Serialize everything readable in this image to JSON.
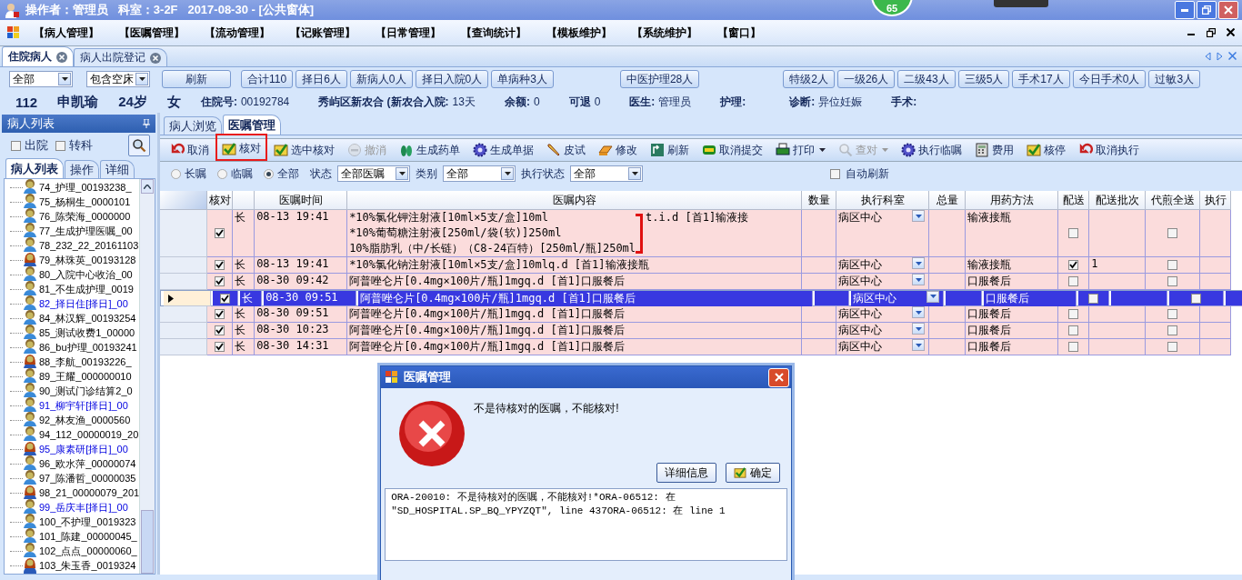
{
  "title_bar": {
    "text": "操作者：管理员   科室：3-2F   2017-08-30 - [公共窗体]",
    "badge": "65"
  },
  "menu": [
    "【病人管理】",
    "【医嘱管理】",
    "【流动管理】",
    "【记账管理】",
    "【日常管理】",
    "【查询统计】",
    "【模板维护】",
    "【系统维护】",
    "【窗口】"
  ],
  "doc_tabs": [
    {
      "label": "住院病人",
      "selected": true
    },
    {
      "label": "病人出院登记",
      "selected": false
    }
  ],
  "filter": {
    "selects": [
      "全部",
      "包含空床"
    ],
    "buttons": [
      "刷新",
      "合计110",
      "择日6人",
      "新病人0人",
      "择日入院0人",
      "单病种3人",
      "中医护理28人"
    ],
    "buttons_right": [
      "特级2人",
      "一级26人",
      "二级43人",
      "三级5人",
      "手术17人",
      "今日手术0人",
      "过敏3人"
    ]
  },
  "patient_info": {
    "bed": "112",
    "name": "申凯瑜",
    "age": "24岁",
    "sex": "女",
    "fields": [
      {
        "label": "住院号:",
        "value": "00192784"
      },
      {
        "label": "秀屿区新农合 (新农合入院:",
        "value": "13天"
      },
      {
        "label": "余额:",
        "value": "0"
      },
      {
        "label": "可退",
        "value": "0"
      },
      {
        "label": "医生:",
        "value": "管理员"
      },
      {
        "label": "护理:"
      },
      {
        "label": "诊断:",
        "value": "异位妊娠"
      },
      {
        "label": "手术:"
      }
    ]
  },
  "sidebar": {
    "title": "病人列表",
    "checks": [
      {
        "label": "出院",
        "checked": false
      },
      {
        "label": "转科",
        "checked": false
      }
    ],
    "tabs": [
      {
        "label": "病人列表",
        "selected": true
      },
      {
        "label": "操作",
        "selected": false
      },
      {
        "label": "详细",
        "selected": false
      }
    ],
    "patients": [
      {
        "label": "74_护理_00193238_",
        "female": false,
        "scheduled": false
      },
      {
        "label": "75_杨桐生_0000101",
        "female": false,
        "scheduled": false
      },
      {
        "label": "76_陈荣海_0000000",
        "female": false,
        "scheduled": false
      },
      {
        "label": "77_生成护理医嘱_00",
        "female": false,
        "scheduled": false
      },
      {
        "label": "78_232_22_20161103",
        "female": false,
        "scheduled": false
      },
      {
        "label": "79_林珠英_00193128",
        "female": true,
        "scheduled": false
      },
      {
        "label": "80_入院中心收治_00",
        "female": false,
        "scheduled": false
      },
      {
        "label": "81_不生成护理_0019",
        "female": false,
        "scheduled": false
      },
      {
        "label": "82_择日住[择日]_00",
        "female": false,
        "scheduled": true
      },
      {
        "label": "84_林汉辉_00193254",
        "female": false,
        "scheduled": false
      },
      {
        "label": "85_测试收费1_00000",
        "female": false,
        "scheduled": false
      },
      {
        "label": "86_bu护理_00193241",
        "female": false,
        "scheduled": false
      },
      {
        "label": "88_李航_00193226_",
        "female": true,
        "scheduled": false
      },
      {
        "label": "89_王耀_000000010",
        "female": false,
        "scheduled": false
      },
      {
        "label": "90_测试门诊结算2_0",
        "female": false,
        "scheduled": false
      },
      {
        "label": "91_柳宇轩[择日]_00",
        "female": false,
        "scheduled": true
      },
      {
        "label": "92_林友渔_0000560",
        "female": false,
        "scheduled": false
      },
      {
        "label": "94_112_00000019_20",
        "female": false,
        "scheduled": false
      },
      {
        "label": "95_康素研[择日]_00",
        "female": true,
        "scheduled": true
      },
      {
        "label": "96_欧水萍_00000074",
        "female": false,
        "scheduled": false
      },
      {
        "label": "97_陈潘哲_00000035",
        "female": false,
        "scheduled": false
      },
      {
        "label": "98_21_00000079_201",
        "female": true,
        "scheduled": false
      },
      {
        "label": "99_岳庆丰[择日]_00",
        "female": false,
        "scheduled": true
      },
      {
        "label": "100_不护理_0019323",
        "female": false,
        "scheduled": false
      },
      {
        "label": "101_陈建_00000045_",
        "female": false,
        "scheduled": false
      },
      {
        "label": "102_点点_00000060_",
        "female": false,
        "scheduled": false
      },
      {
        "label": "103_朱玉香_0019324",
        "female": true,
        "scheduled": false
      }
    ]
  },
  "sub_tabs": [
    {
      "label": "病人浏览",
      "selected": false
    },
    {
      "label": "医嘱管理",
      "selected": true
    }
  ],
  "toolbar": [
    {
      "label": "取消",
      "disabled": false,
      "highlighted": false,
      "dropdown": false
    },
    {
      "label": "核对",
      "disabled": false,
      "highlighted": true,
      "dropdown": false
    },
    {
      "label": "选中核对",
      "disabled": false,
      "highlighted": false,
      "dropdown": false
    },
    {
      "label": "撤消",
      "disabled": true,
      "highlighted": false,
      "dropdown": false
    },
    {
      "label": "生成药单",
      "disabled": false,
      "highlighted": false,
      "dropdown": false
    },
    {
      "label": "生成单据",
      "disabled": false,
      "highlighted": false,
      "dropdown": false
    },
    {
      "label": "皮试",
      "disabled": false,
      "highlighted": false,
      "dropdown": false
    },
    {
      "label": "修改",
      "disabled": false,
      "highlighted": false,
      "dropdown": false
    },
    {
      "label": "刷新",
      "disabled": false,
      "highlighted": false,
      "dropdown": false
    },
    {
      "label": "取消提交",
      "disabled": false,
      "highlighted": false,
      "dropdown": false
    },
    {
      "label": "打印",
      "disabled": false,
      "highlighted": false,
      "dropdown": true
    },
    {
      "label": "查对",
      "disabled": true,
      "highlighted": false,
      "dropdown": true
    },
    {
      "label": "执行临嘱",
      "disabled": false,
      "highlighted": false,
      "dropdown": false
    },
    {
      "label": "费用",
      "disabled": false,
      "highlighted": false,
      "dropdown": false
    },
    {
      "label": "核停",
      "disabled": false,
      "highlighted": false,
      "dropdown": false
    },
    {
      "label": "取消执行",
      "disabled": false,
      "highlighted": false,
      "dropdown": false
    }
  ],
  "order_filter": {
    "radios": [
      {
        "label": "长嘱",
        "selected": false
      },
      {
        "label": "临嘱",
        "selected": false
      },
      {
        "label": "全部",
        "selected": true
      }
    ],
    "fields": [
      {
        "label": "状态",
        "value": "全部医嘱"
      },
      {
        "label": "类别",
        "value": "全部"
      },
      {
        "label": "执行状态",
        "value": "全部"
      }
    ],
    "auto_refresh": {
      "label": "自动刷新",
      "checked": false
    }
  },
  "table": {
    "columns": [
      "核对",
      "医嘱时间",
      "医嘱内容",
      "数量",
      "执行科室",
      "总量",
      "用药方法",
      "配送",
      "配送批次",
      "代煎全送",
      "执行"
    ],
    "rows": [
      {
        "checked": true,
        "type": "长",
        "time": "08-13 19:41",
        "content": [
          "*10%氯化钾注射液[10ml×5支/盒]10ml",
          "*10%葡萄糖注射液[250ml/袋(软)]250ml",
          "10%脂肪乳（中/长链）（C8-24百特）[250ml/瓶]250ml"
        ],
        "frequency": "t.i.d  [首1]输液接",
        "dept": "病区中心",
        "method": "输液接瓶",
        "delivery": false,
        "decoct": false,
        "selected": false
      },
      {
        "checked": true,
        "type": "长",
        "time": "08-13 19:41",
        "content": [
          "*10%氯化钠注射液[10ml×5支/盒]10mlq.d  [首1]输液接瓶"
        ],
        "dept": "病区中心",
        "method": "输液接瓶",
        "delivery": true,
        "batch": "1",
        "decoct": false,
        "selected": false
      },
      {
        "checked": true,
        "type": "长",
        "time": "08-30 09:42",
        "content": [
          "阿普唑仑片[0.4mg×100片/瓶]1mgq.d  [首1]口服餐后"
        ],
        "dept": "病区中心",
        "method": "口服餐后",
        "delivery": false,
        "decoct": false,
        "selected": false
      },
      {
        "checked": true,
        "type": "长",
        "time": "08-30 09:51",
        "content": [
          "阿普唑仑片[0.4mg×100片/瓶]1mgq.d  [首1]口服餐后"
        ],
        "dept": "病区中心",
        "method": "口服餐后",
        "delivery": false,
        "decoct": false,
        "selected": true
      },
      {
        "checked": true,
        "type": "长",
        "time": "08-30 09:51",
        "content": [
          "阿普唑仑片[0.4mg×100片/瓶]1mgq.d  [首1]口服餐后"
        ],
        "dept": "病区中心",
        "method": "口服餐后",
        "delivery": false,
        "decoct": false,
        "selected": false
      },
      {
        "checked": true,
        "type": "长",
        "time": "08-30 10:23",
        "content": [
          "阿普唑仑片[0.4mg×100片/瓶]1mgq.d  [首1]口服餐后"
        ],
        "dept": "病区中心",
        "method": "口服餐后",
        "delivery": false,
        "decoct": false,
        "selected": false
      },
      {
        "checked": true,
        "type": "长",
        "time": "08-30 14:31",
        "content": [
          "阿普唑仑片[0.4mg×100片/瓶]1mgq.d  [首1]口服餐后"
        ],
        "dept": "病区中心",
        "method": "口服餐后",
        "delivery": false,
        "decoct": false,
        "selected": false
      }
    ]
  },
  "dialog": {
    "title": "医嘱管理",
    "message": "不是待核对的医嘱，不能核对!",
    "buttons": [
      "详细信息",
      "确定"
    ],
    "detail": "ORA-20010: 不是待核对的医嘱，不能核对!*ORA-06512: 在 \"SD_HOSPITAL.SP_BQ_YPYZQT\", line 437ORA-06512: 在 line 1"
  }
}
